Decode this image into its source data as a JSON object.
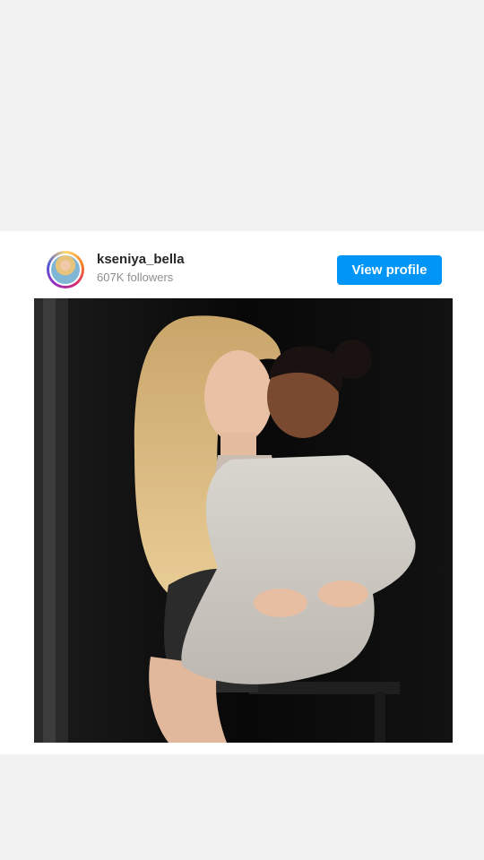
{
  "post": {
    "username": "kseniya_bella",
    "followers": "607K followers",
    "view_profile_label": "View profile",
    "accent_color": "#0095f6"
  },
  "media": {
    "icon": "photo-woman-and-child"
  }
}
